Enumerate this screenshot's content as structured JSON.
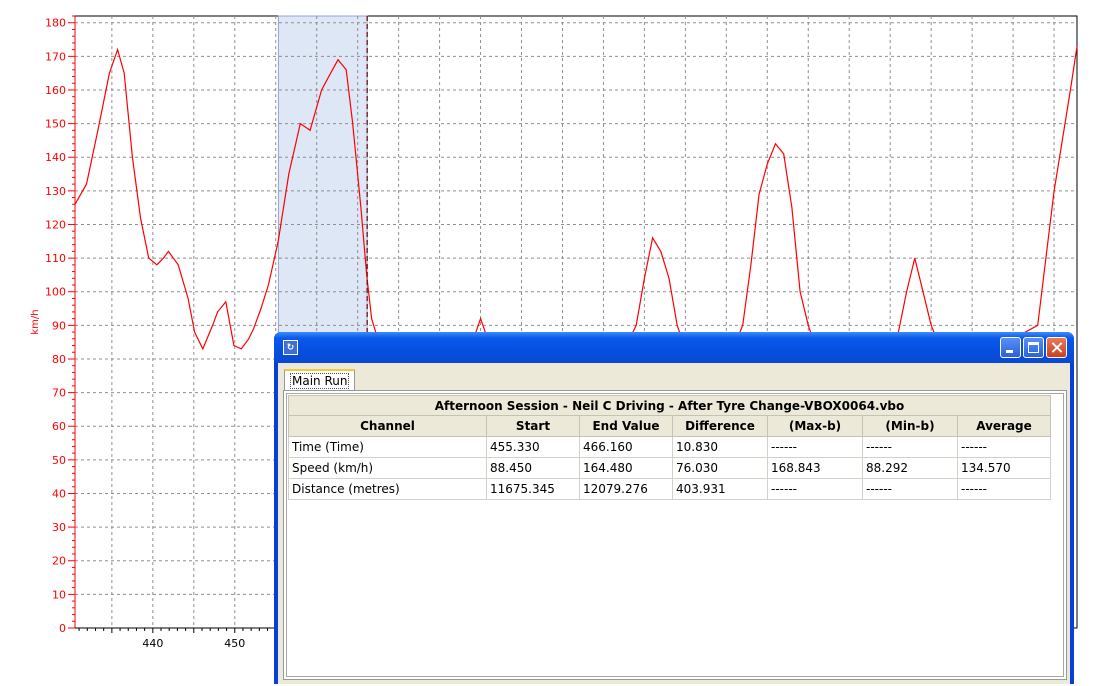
{
  "chart_data": {
    "type": "line",
    "ylabel": "km/h",
    "xlabel": "",
    "xlim": [
      430.5,
      552.8
    ],
    "ylim": [
      0,
      182
    ],
    "x_ticks": [
      440,
      450
    ],
    "y_ticks": [
      0,
      10,
      20,
      30,
      40,
      50,
      60,
      70,
      80,
      90,
      100,
      110,
      120,
      130,
      140,
      150,
      160,
      170,
      180
    ],
    "grid": true,
    "selection": {
      "start": 455.33,
      "end": 466.16
    },
    "cursor_x": 466.16,
    "series": [
      {
        "color": "#ff0000",
        "x": [
          430.5,
          431.9,
          433.3,
          434.7,
          435.7,
          436.5,
          437.5,
          438.5,
          439.5,
          440.5,
          441.3,
          441.9,
          443.1,
          444.3,
          445.1,
          446.1,
          447.3,
          447.9,
          448.9,
          449.9,
          450.8,
          451.7,
          452.3,
          453.2,
          454.1,
          455.3,
          456.6,
          458.0,
          459.2,
          460.6,
          461.7,
          462.6,
          463.6,
          464.4,
          465.4,
          466.1,
          466.7,
          467.7,
          468.6,
          469.6,
          470.6,
          471.6,
          472.6,
          476.0,
          479.0,
          480.0,
          481.0,
          482.0,
          484.0,
          486.0,
          487.0,
          488.0,
          489.0,
          490.0,
          491.0,
          492.0,
          493.0,
          496.0,
          498.0,
          499.0,
          500.0,
          501.0,
          502.0,
          503.0,
          504.0,
          505.0,
          509.0,
          511.0,
          512.0,
          513.0,
          514.0,
          515.0,
          516.0,
          517.0,
          518.0,
          519.0,
          520.0,
          521.0,
          522.0,
          523.0,
          525.0,
          528.0,
          530.0,
          531.0,
          532.0,
          533.0,
          534.0,
          535.0,
          536.0,
          537.0,
          538.0,
          539.0,
          540.0,
          541.0,
          542.0,
          543.0,
          545.0,
          548.0,
          549.0,
          550.0,
          551.0,
          552.0,
          552.8
        ],
        "y": [
          126,
          132,
          148,
          165,
          172,
          165,
          140,
          122,
          110,
          108,
          110,
          112,
          108,
          98,
          88,
          83,
          90,
          94,
          97,
          84,
          83,
          86,
          89,
          95,
          102,
          115,
          135,
          150,
          148,
          160,
          165,
          169,
          166,
          150,
          125,
          105,
          92,
          84,
          80,
          82,
          83,
          86,
          84,
          84,
          85,
          92,
          85,
          84,
          83,
          84,
          84,
          82,
          84,
          84,
          84,
          83,
          84,
          84,
          85,
          90,
          104,
          116,
          112,
          104,
          90,
          83,
          82,
          84,
          90,
          108,
          129,
          138,
          144,
          141,
          125,
          100,
          90,
          83,
          82,
          84,
          84,
          84,
          85,
          88,
          100,
          110,
          100,
          90,
          84,
          82,
          84,
          84,
          84,
          86,
          84,
          84,
          86,
          90,
          110,
          130,
          145,
          160,
          173
        ]
      }
    ]
  },
  "window": {
    "icon": "app-icon",
    "tab": "Main Run",
    "table": {
      "title": "Afternoon Session - Neil C Driving - After Tyre Change-VBOX0064.vbo",
      "headers": [
        "Channel",
        "Start",
        "End Value",
        "Difference",
        "(Max-b)",
        "(Min-b)",
        "Average"
      ],
      "rows": [
        [
          "Time (Time)",
          "455.330",
          "466.160",
          "10.830",
          "------",
          "------",
          "------"
        ],
        [
          "Speed (km/h)",
          "88.450",
          "164.480",
          "76.030",
          "168.843",
          "88.292",
          "134.570"
        ],
        [
          "Distance (metres)",
          "11675.345",
          "12079.276",
          "403.931",
          "------",
          "------",
          "------"
        ]
      ]
    }
  },
  "colors": {
    "series": "#ff0000",
    "axis": "#ff0000",
    "selection_fill": "#dde7f6",
    "titlebar": "#0a58ec"
  }
}
